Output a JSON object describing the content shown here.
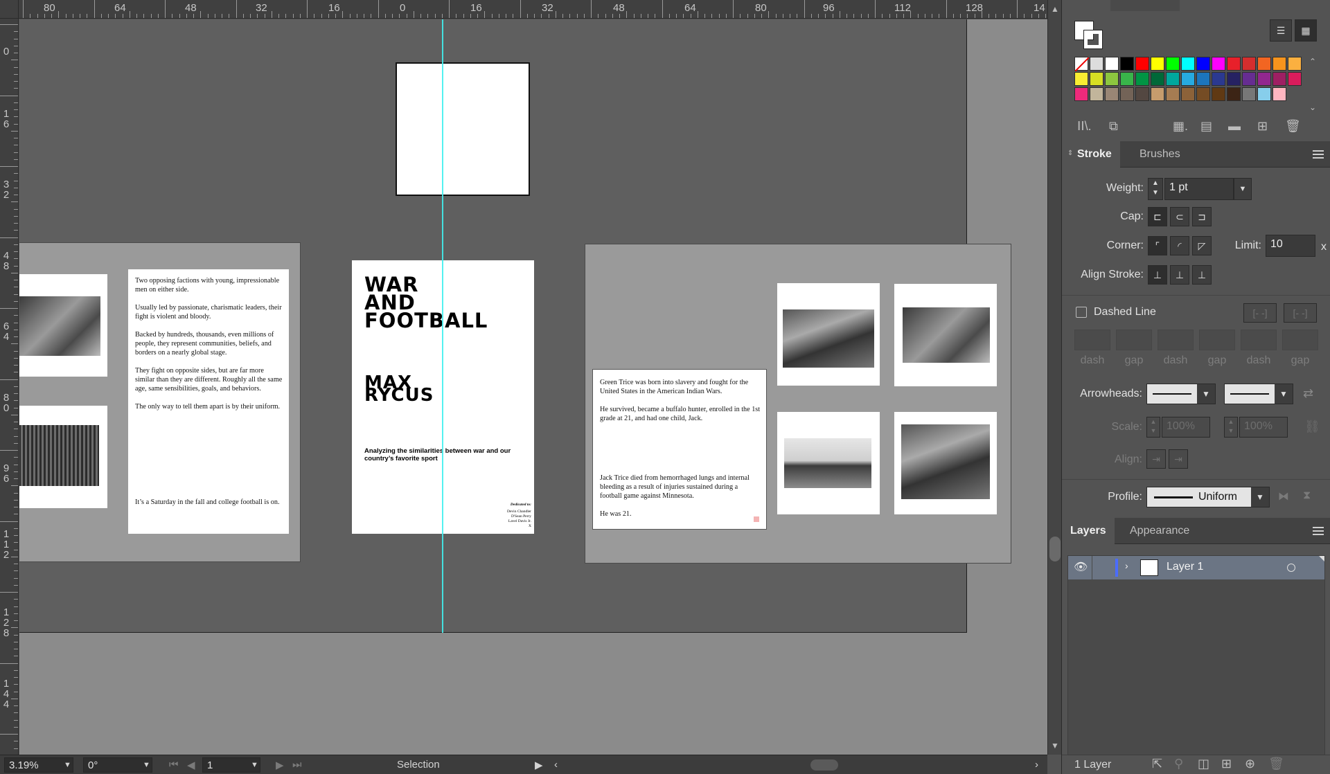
{
  "ruler": {
    "top_labels": [
      "80",
      "64",
      "48",
      "32",
      "16",
      "0",
      "16",
      "32",
      "48",
      "64",
      "80",
      "96",
      "112",
      "128",
      "14"
    ],
    "left_labels": [
      "0",
      "1\n6",
      "3\n2",
      "4\n8",
      "6\n4",
      "8\n0",
      "9\n6",
      "1\n1\n2",
      "1\n2\n8",
      "1\n4\n4"
    ]
  },
  "document": {
    "left_spread": {
      "paragraphs": [
        "Two opposing factions with young, impressionable men on either side.",
        "Usually led by passionate, charismatic leaders, their fight is violent and bloody.",
        "Backed by hundreds, thousands, even millions of people, they represent communities, beliefs, and borders on a nearly global stage.",
        "They fight on opposite sides, but are far more similar than they are different. Roughly all the same age, same sensibilities, goals, and behaviors.",
        "The only way to tell them apart is by their uniform."
      ],
      "footer_text": "It’s a Saturday in the fall and college football is on."
    },
    "cover": {
      "title_lines": [
        "WAR",
        "AND",
        "FOOTBALL"
      ],
      "author_lines": [
        "MAX",
        "RYCUS"
      ],
      "subtitle": "Analyzing the similarities between war and our country’s favorite sport",
      "dedication_heading": "Dedicated to:",
      "dedication_names": [
        "Devin Chandler",
        "D'Sean Perry",
        "Lavel Davis Jr.",
        "X"
      ]
    },
    "right_spread": {
      "paragraphs": [
        "Green Trice was born into slavery and fought for the United States in the American Indian Wars.",
        "He survived, became a buffalo hunter, enrolled in the 1st grade at 21, and had one child, Jack."
      ],
      "paragraphs2": [
        "Jack Trice died from hemorrhaged lungs and internal bleeding as a result of injuries sustained during a football game against Minnesota.",
        "He was 21."
      ]
    }
  },
  "statusbar": {
    "zoom": "3.19%",
    "rotation": "0°",
    "artboard": "1",
    "tool": "Selection"
  },
  "swatches": {
    "colors": [
      "#ffffff",
      "#000000",
      "#ff0000",
      "#ffff00",
      "#00ff00",
      "#00ffff",
      "#0000ff",
      "#ff00ff",
      "#e8202a",
      "#d42e2e",
      "#f26522",
      "#f7941d",
      "#fbb040",
      "#f9ed32",
      "#d7df23",
      "#8dc63f",
      "#39b54a",
      "#009444",
      "#006838",
      "#00a79d",
      "#27aae1",
      "#1c75bc",
      "#2b3990",
      "#262262",
      "#662d91",
      "#92278f",
      "#9e1f63",
      "#da1c5c",
      "#ee2a7b",
      "#c2b59b",
      "#998675",
      "#736357",
      "#534741",
      "#c69c6d",
      "#a67c52",
      "#8c6239",
      "#754c24",
      "#603913",
      "#3c2415",
      "#777777",
      "#87ceeb",
      "#ffb6c1"
    ]
  },
  "stroke_panel": {
    "tabs": [
      "Stroke",
      "Brushes"
    ],
    "weight_label": "Weight:",
    "weight_value": "1 pt",
    "cap_label": "Cap:",
    "corner_label": "Corner:",
    "limit_label": "Limit:",
    "limit_value": "10",
    "limit_x": "x",
    "align_label": "Align Stroke:",
    "dashed_label": "Dashed Line",
    "dash_labels": [
      "dash",
      "gap",
      "dash",
      "gap",
      "dash",
      "gap"
    ],
    "arrowheads_label": "Arrowheads:",
    "scale_label": "Scale:",
    "scale_value1": "100%",
    "scale_value2": "100%",
    "align_label2": "Align:",
    "profile_label": "Profile:",
    "profile_value": "Uniform"
  },
  "layers_panel": {
    "tabs": [
      "Layers",
      "Appearance"
    ],
    "layer_name": "Layer 1",
    "footer": "1 Layer"
  }
}
